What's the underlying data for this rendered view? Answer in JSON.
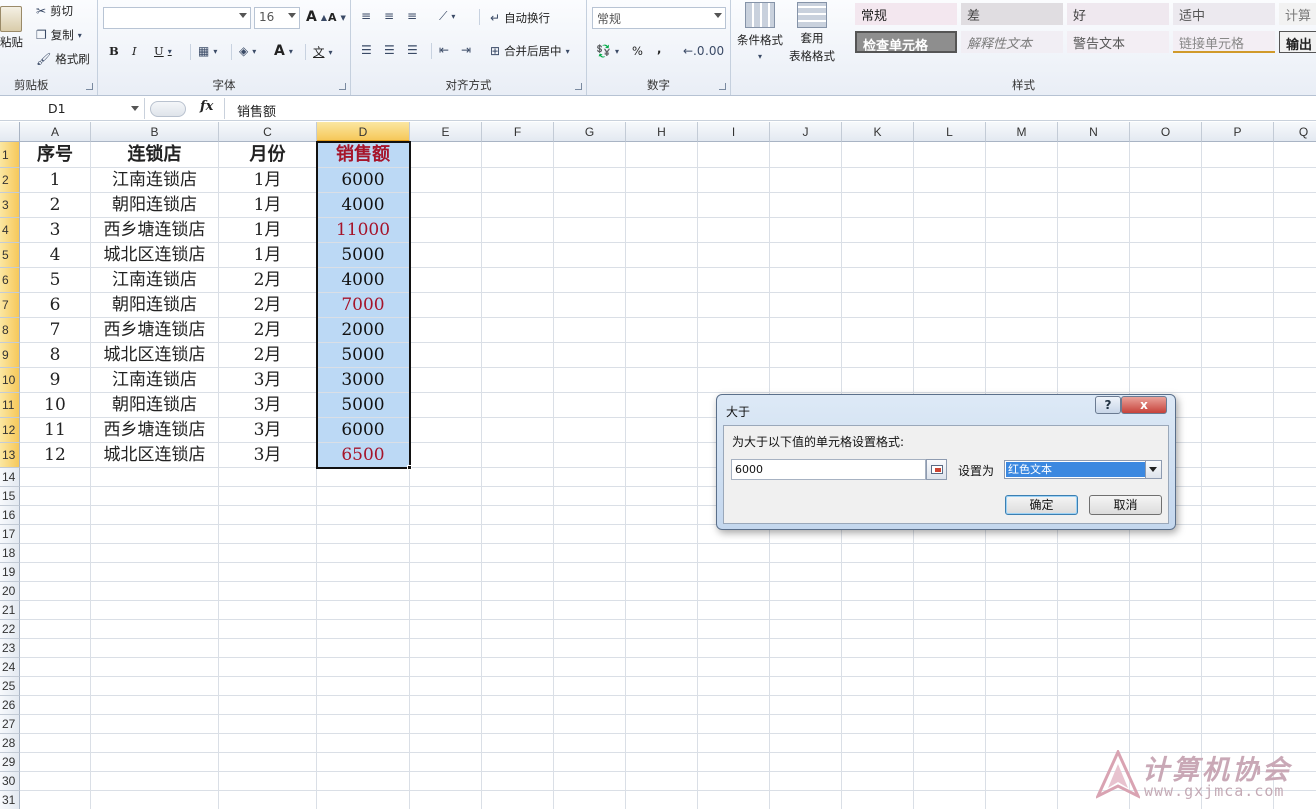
{
  "ribbon": {
    "clipboard": {
      "paste": "粘贴",
      "cut": "剪切",
      "copy": "复制",
      "format_painter": "格式刷",
      "label": "剪贴板"
    },
    "font": {
      "font_name": "",
      "font_size": "16",
      "grow": "A",
      "shrink": "A",
      "bold": "B",
      "italic": "I",
      "underline": "U",
      "font_color_letter": "A",
      "phonetic": "文",
      "label": "字体"
    },
    "alignment": {
      "wrap_text": "自动换行",
      "merge_center": "合并后居中",
      "label": "对齐方式"
    },
    "number": {
      "format": "常规",
      "percent": "%",
      "comma": ",",
      "label": "数字"
    },
    "styles": {
      "conditional_formatting": "条件格式",
      "format_as_table_line1": "套用",
      "format_as_table_line2": "表格格式",
      "label": "样式",
      "cells": [
        {
          "text": "常规",
          "bg": "#f3e7ef",
          "color": "#222"
        },
        {
          "text": "差",
          "bg": "#e0dde1",
          "color": "#444"
        },
        {
          "text": "好",
          "bg": "#efe8ef",
          "color": "#444"
        },
        {
          "text": "适中",
          "bg": "#ece9ef",
          "color": "#555"
        },
        {
          "text": "计算",
          "bg": "#f2f2f2",
          "color": "#7a7a7a"
        },
        {
          "text": "检查单元格",
          "bg": "#8e8e8e",
          "color": "#ffffff"
        },
        {
          "text": "解释性文本",
          "bg": "#f1eef4",
          "color": "#7a7a7a"
        },
        {
          "text": "警告文本",
          "bg": "#f3eef4",
          "color": "#555"
        },
        {
          "text": "链接单元格",
          "bg": "#f3eef4",
          "color": "#888"
        },
        {
          "text": "输出",
          "bg": "#f2f2f2",
          "color": "#222"
        }
      ]
    }
  },
  "formula_bar": {
    "name_box": "D1",
    "fx": "fx",
    "content": "销售额"
  },
  "sheet": {
    "columns": [
      "A",
      "B",
      "C",
      "D",
      "E",
      "F",
      "G",
      "H",
      "I",
      "J",
      "K",
      "L",
      "M",
      "N",
      "O",
      "P",
      "Q"
    ],
    "row_numbers": [
      "1",
      "2",
      "3",
      "4",
      "5",
      "6",
      "7",
      "8",
      "9",
      "10",
      "11",
      "12",
      "13",
      "14",
      "15",
      "16",
      "17",
      "18",
      "19",
      "20",
      "21",
      "22",
      "23",
      "24",
      "25",
      "26",
      "27",
      "28",
      "29",
      "30",
      "31"
    ],
    "header": [
      "序号",
      "连锁店",
      "月份",
      "销售额"
    ],
    "rows": [
      [
        "1",
        "江南连锁店",
        "1月",
        "6000"
      ],
      [
        "2",
        "朝阳连锁店",
        "1月",
        "4000"
      ],
      [
        "3",
        "西乡塘连锁店",
        "1月",
        "11000"
      ],
      [
        "4",
        "城北区连锁店",
        "1月",
        "5000"
      ],
      [
        "5",
        "江南连锁店",
        "2月",
        "4000"
      ],
      [
        "6",
        "朝阳连锁店",
        "2月",
        "7000"
      ],
      [
        "7",
        "西乡塘连锁店",
        "2月",
        "2000"
      ],
      [
        "8",
        "城北区连锁店",
        "2月",
        "5000"
      ],
      [
        "9",
        "江南连锁店",
        "3月",
        "3000"
      ],
      [
        "10",
        "朝阳连锁店",
        "3月",
        "5000"
      ],
      [
        "11",
        "西乡塘连锁店",
        "3月",
        "6000"
      ],
      [
        "12",
        "城北区连锁店",
        "3月",
        "6500"
      ]
    ],
    "highlight_color": "#a6142a",
    "selection_color": "#bcd9f5"
  },
  "dialog": {
    "title": "大于",
    "help": "?",
    "close": "x",
    "description": "为大于以下值的单元格设置格式:",
    "value": "6000",
    "set_as_label": "设置为",
    "format_option": "红色文本",
    "ok": "确定",
    "cancel": "取消"
  },
  "watermark": {
    "title": "计算机协会",
    "url": "www.gxjmca.com"
  }
}
